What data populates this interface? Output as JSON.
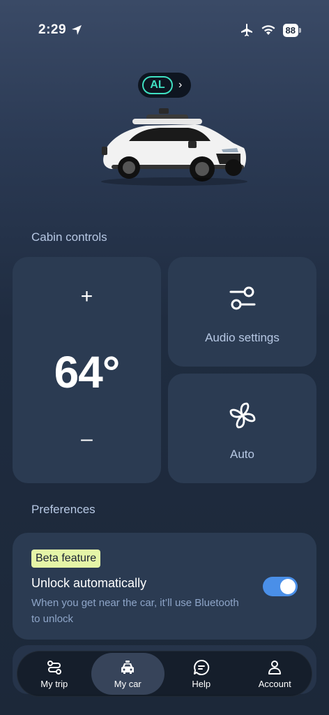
{
  "status": {
    "time": "2:29",
    "battery": "88"
  },
  "vehicle": {
    "code": "AL"
  },
  "cabin": {
    "title": "Cabin controls",
    "temp_plus": "+",
    "temperature": "64°",
    "temp_minus": "–",
    "audio_label": "Audio settings",
    "fan_label": "Auto"
  },
  "preferences": {
    "title": "Preferences",
    "beta_tag": "Beta feature",
    "unlock_title": "Unlock automatically",
    "unlock_desc": "When you get near the car, it’ll use Bluetooth to unlock",
    "unlock_enabled": true
  },
  "nav": {
    "items": [
      {
        "label": "My trip",
        "icon": "route-icon"
      },
      {
        "label": "My car",
        "icon": "car-icon"
      },
      {
        "label": "Help",
        "icon": "chat-bubble-icon"
      },
      {
        "label": "Account",
        "icon": "person-icon"
      }
    ],
    "active": "My car"
  },
  "colors": {
    "accent": "#3fe0c2",
    "toggle": "#4a8fe8",
    "beta": "#e5f5a7"
  }
}
